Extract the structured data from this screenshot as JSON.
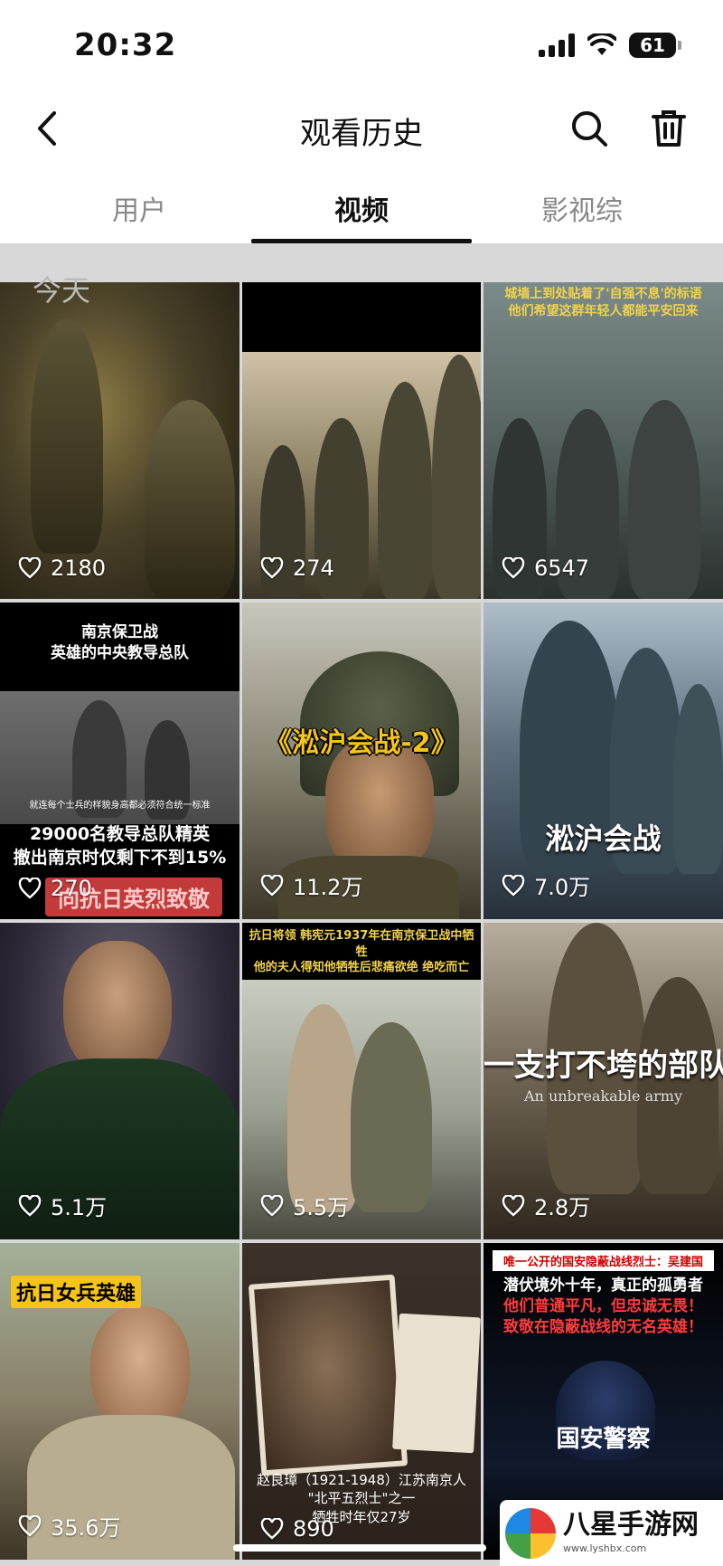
{
  "status": {
    "time": "20:32",
    "battery": "61"
  },
  "nav": {
    "title": "观看历史",
    "back": "back-icon",
    "search": "search-icon",
    "delete": "trash-icon"
  },
  "tabs": [
    {
      "label": "用户",
      "active": false
    },
    {
      "label": "视频",
      "active": true
    },
    {
      "label": "影视综",
      "active": false
    }
  ],
  "section": {
    "label": "今天"
  },
  "videos": [
    {
      "likes": "2180",
      "captions": []
    },
    {
      "likes": "274",
      "captions": []
    },
    {
      "likes": "6547",
      "captions": [
        "城墙上到处贴着了'自强不息'的标语",
        "他们希望这群年轻人都能平安回来"
      ]
    },
    {
      "likes": "270",
      "captions": [
        "南京保卫战",
        "英雄的中央教导总队",
        "就连每个士兵的样貌身高都必须符合统一标准",
        "29000名教导总队精英",
        "撤出南京时仅剩下不到15%",
        "向抗日英烈致敬"
      ]
    },
    {
      "likes": "11.2万",
      "captions": [
        "《淞沪会战-2》"
      ]
    },
    {
      "likes": "7.0万",
      "captions": [
        "淞沪会战"
      ]
    },
    {
      "likes": "5.1万",
      "captions": []
    },
    {
      "likes": "5.5万",
      "captions": [
        "抗日将领 韩宪元1937年在南京保卫战中牺牲",
        "他的夫人得知他牺牲后悲痛欲绝 绝吃而亡"
      ]
    },
    {
      "likes": "2.8万",
      "captions": [
        "一支打不垮的部队",
        "An unbreakable army"
      ]
    },
    {
      "likes": "35.6万",
      "captions": [
        "抗日女兵英雄"
      ]
    },
    {
      "likes": "890",
      "captions": [
        "赵良璋（1921-1948）江苏南京人",
        "\"北平五烈士\"之一",
        "牺牲时年仅27岁"
      ]
    },
    {
      "likes": "",
      "captions": [
        "唯一公开的国安隐蔽战线烈士：吴建国",
        "潜伏境外十年，真正的孤勇者",
        "他们普通平凡，但忠诚无畏！",
        "致敬在隐蔽战线的无名英雄！",
        "国安警察"
      ]
    }
  ],
  "watermark": {
    "text": "八星手游网",
    "url": "www.lyshbx.com"
  },
  "colors": {
    "tabIndicator": "#111111",
    "sectionBg": "#d8d8d8",
    "accentYellow": "#f4c518",
    "accentRed": "#c23a3a"
  }
}
